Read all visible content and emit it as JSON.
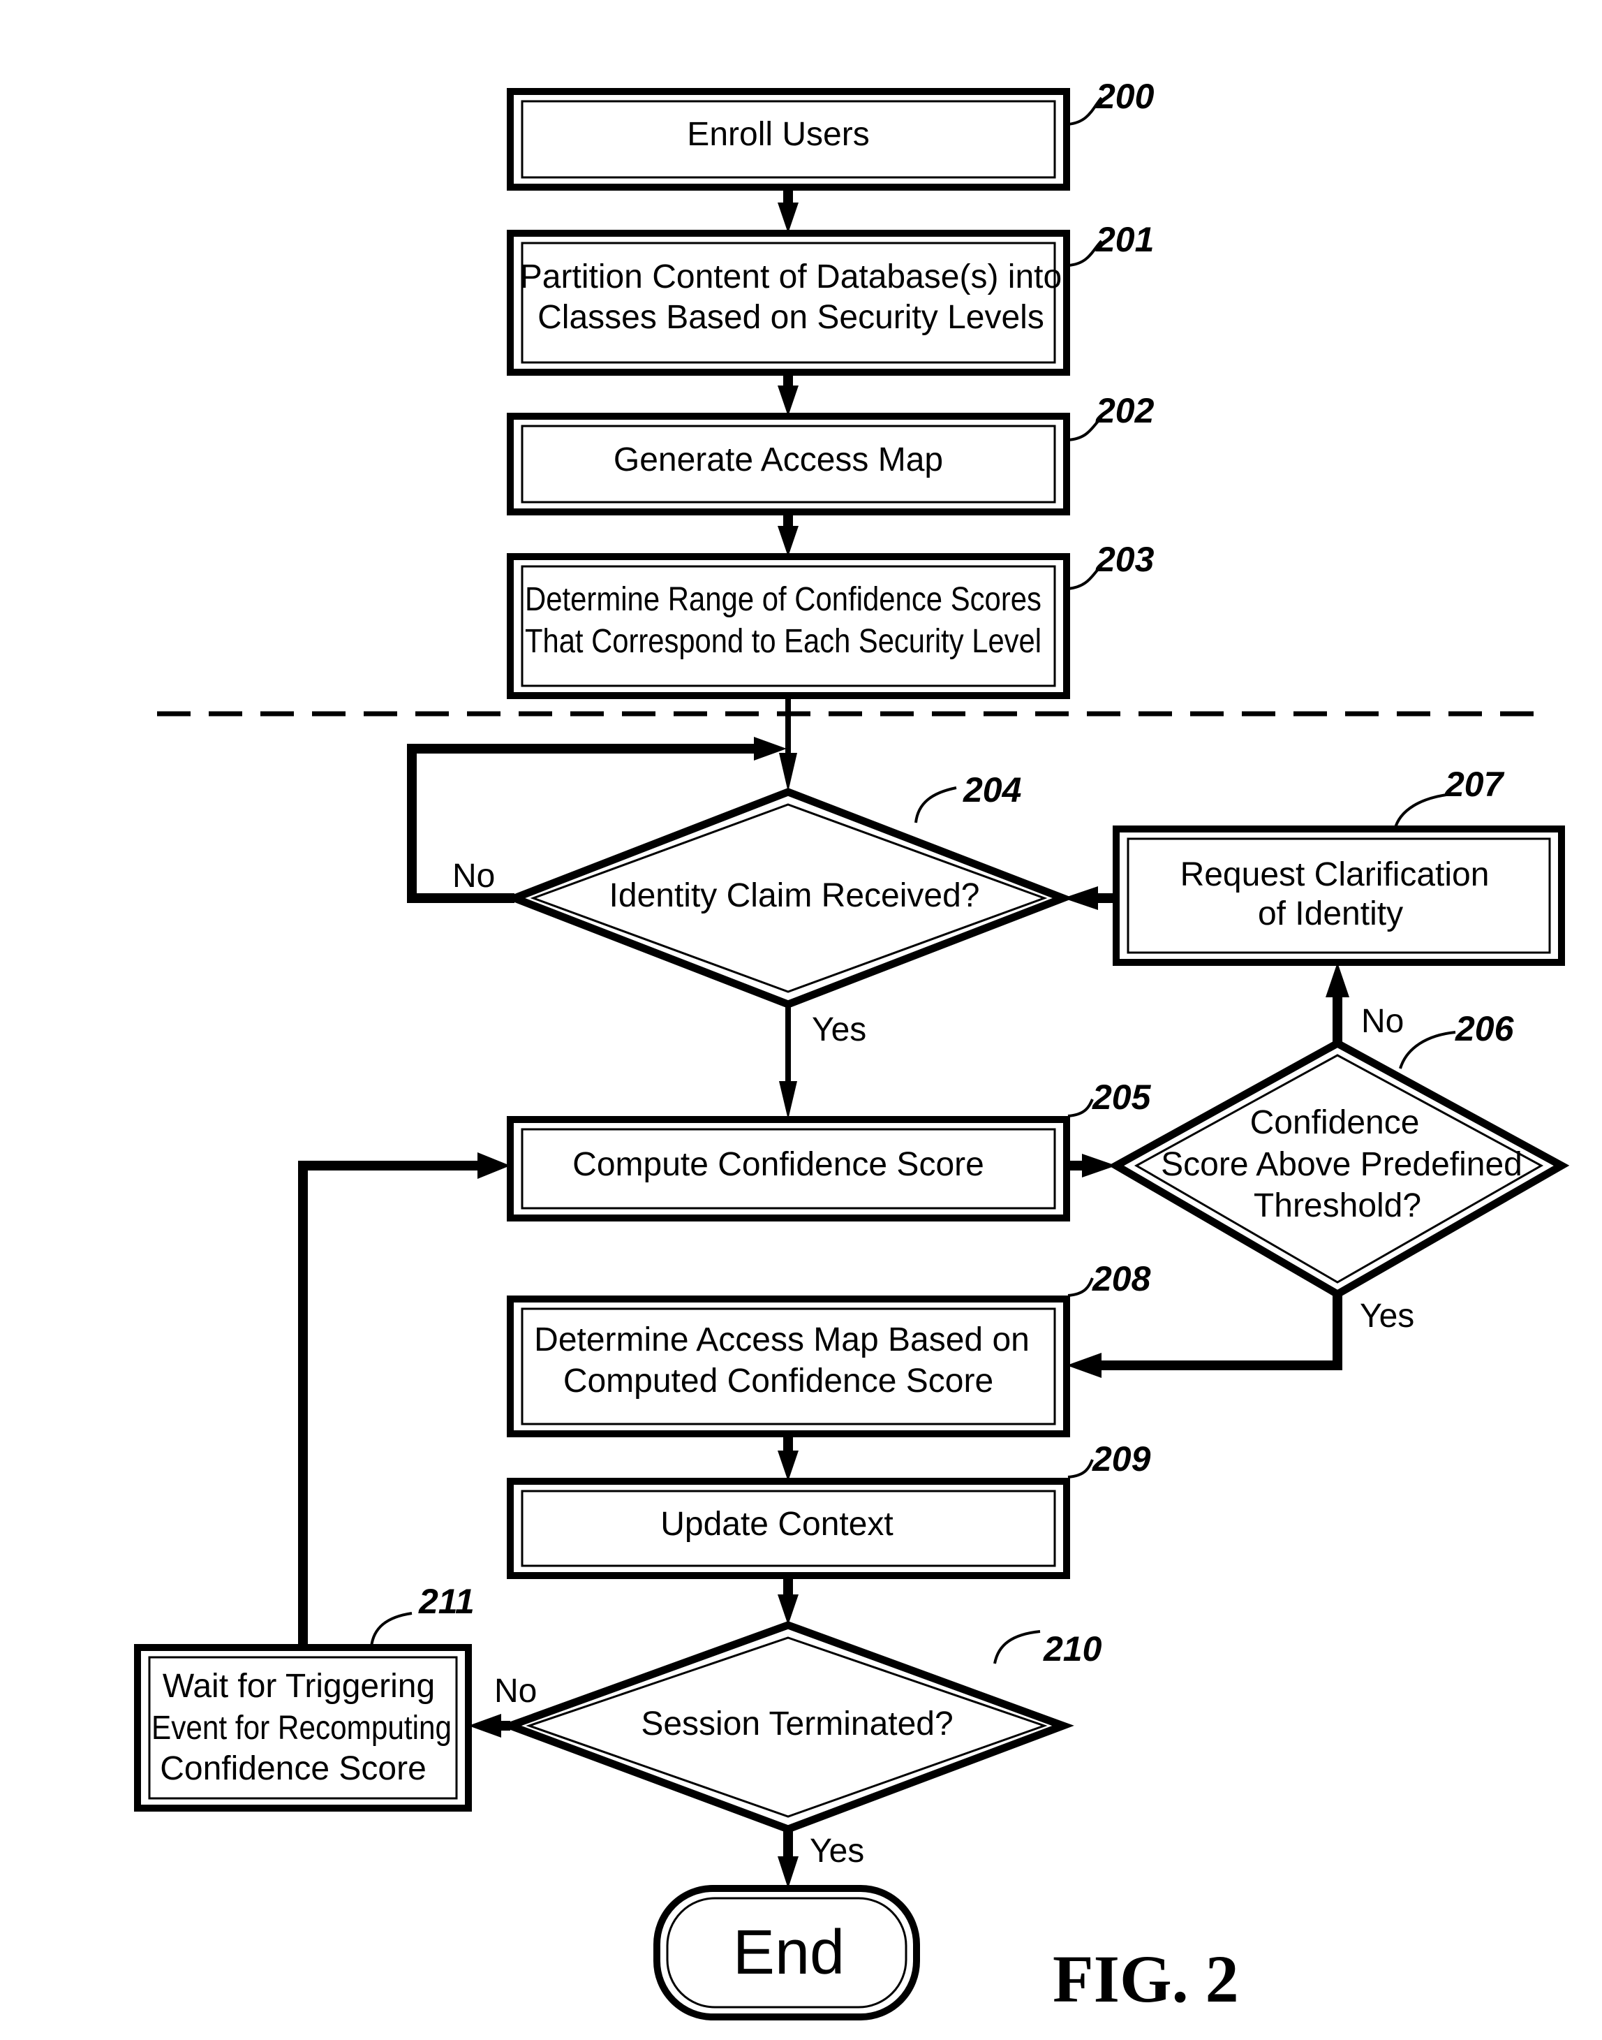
{
  "figure": {
    "label": "FIG. 2"
  },
  "nodes": {
    "n200": {
      "ref": "200",
      "type": "process",
      "lines": [
        "Enroll Users"
      ]
    },
    "n201": {
      "ref": "201",
      "type": "process",
      "lines": [
        "Partition Content of Database(s) into",
        "Classes Based on Security Levels"
      ]
    },
    "n202": {
      "ref": "202",
      "type": "process",
      "lines": [
        "Generate Access Map"
      ]
    },
    "n203": {
      "ref": "203",
      "type": "process",
      "lines": [
        "Determine Range of Confidence Scores",
        "That Correspond to Each Security Level"
      ]
    },
    "n204": {
      "ref": "204",
      "type": "decision",
      "lines": [
        "Identity Claim Received?"
      ]
    },
    "n205": {
      "ref": "205",
      "type": "process",
      "lines": [
        "Compute Confidence Score"
      ]
    },
    "n206": {
      "ref": "206",
      "type": "decision",
      "lines": [
        "Confidence",
        "Score Above Predefined",
        "Threshold?"
      ]
    },
    "n207": {
      "ref": "207",
      "type": "process",
      "lines": [
        "Request Clarification",
        "of Identity"
      ]
    },
    "n208": {
      "ref": "208",
      "type": "process",
      "lines": [
        "Determine Access Map Based on",
        "Computed Confidence Score"
      ]
    },
    "n209": {
      "ref": "209",
      "type": "process",
      "lines": [
        "Update Context"
      ]
    },
    "n210": {
      "ref": "210",
      "type": "decision",
      "lines": [
        "Session Terminated?"
      ]
    },
    "n211": {
      "ref": "211",
      "type": "process",
      "lines": [
        "Wait for Triggering",
        "Event for Recomputing",
        "Confidence Score"
      ]
    },
    "end": {
      "type": "terminator",
      "label": "End"
    }
  },
  "edges": [
    {
      "from": "200",
      "to": "201",
      "label": ""
    },
    {
      "from": "201",
      "to": "202",
      "label": ""
    },
    {
      "from": "202",
      "to": "203",
      "label": ""
    },
    {
      "from": "203",
      "to": "204",
      "label": ""
    },
    {
      "from": "204",
      "to": "204",
      "label": "No"
    },
    {
      "from": "204",
      "to": "205",
      "label": "Yes"
    },
    {
      "from": "205",
      "to": "206",
      "label": ""
    },
    {
      "from": "206",
      "to": "207",
      "label": "No"
    },
    {
      "from": "207",
      "to": "204",
      "label": ""
    },
    {
      "from": "206",
      "to": "208",
      "label": "Yes"
    },
    {
      "from": "208",
      "to": "209",
      "label": ""
    },
    {
      "from": "209",
      "to": "210",
      "label": ""
    },
    {
      "from": "210",
      "to": "211",
      "label": "No"
    },
    {
      "from": "210",
      "to": "end",
      "label": "Yes"
    },
    {
      "from": "211",
      "to": "205",
      "label": ""
    }
  ],
  "edge_labels": {
    "e204_no": "No",
    "e204_yes": "Yes",
    "e206_no": "No",
    "e206_yes": "Yes",
    "e210_no": "No",
    "e210_yes": "Yes"
  }
}
